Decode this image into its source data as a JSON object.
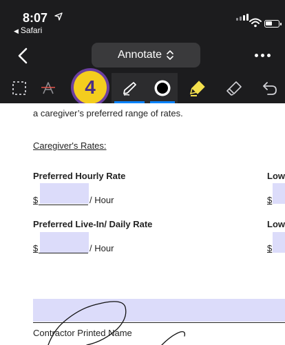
{
  "status_bar": {
    "time": "8:07",
    "back_app": "Safari"
  },
  "nav": {
    "mode_label": "Annotate"
  },
  "toolbar": {
    "tools": [
      {
        "name": "selection-tool",
        "icon": "dashed-rect-icon"
      },
      {
        "name": "strikeout-text-tool",
        "icon": "strikeout-a-icon"
      },
      {
        "name": "pen-tool",
        "icon": "pen-icon",
        "active": true
      },
      {
        "name": "color-tool",
        "icon": "filled-circle-icon"
      },
      {
        "name": "highlighter-tool",
        "icon": "highlighter-icon"
      },
      {
        "name": "eraser-tool",
        "icon": "eraser-icon"
      },
      {
        "name": "undo-tool",
        "icon": "undo-icon"
      }
    ],
    "accent_color": "#0a84ff"
  },
  "step_badge": "4",
  "document": {
    "intro_tail": "a caregiver’s preferred range of rates.",
    "rates_heading": "Caregiver's Rates:",
    "hourly_label": "Preferred Hourly Rate",
    "hourly_right_label": "Low",
    "dollar": "$",
    "hour_unit": "/ Hour",
    "daily_label": "Preferred Live-In/ Daily Rate",
    "daily_right_label": "Low",
    "hour_unit_2": "/ Hour",
    "printed_name_label": "Contractor Printed Name"
  }
}
